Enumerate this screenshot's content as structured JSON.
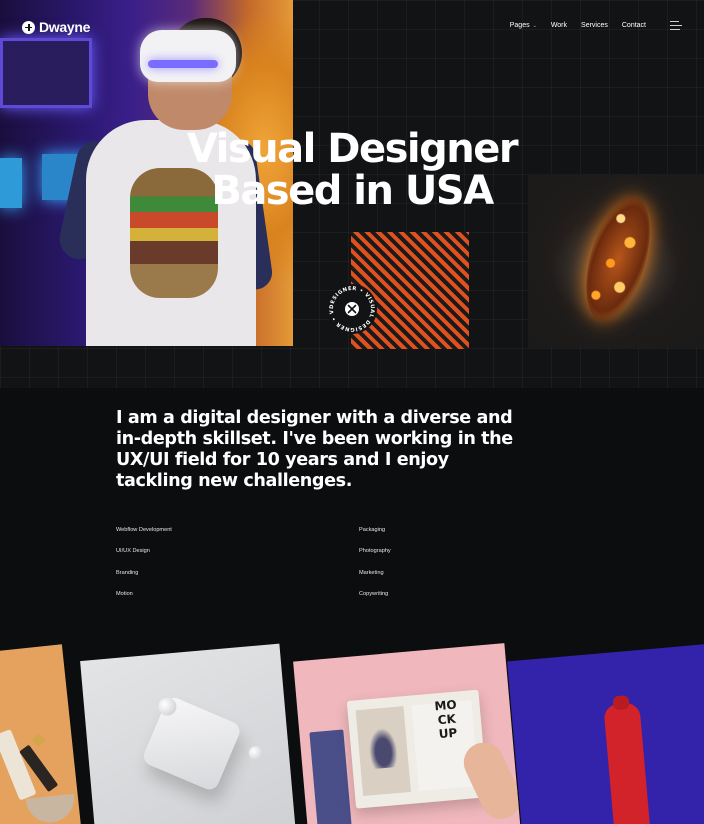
{
  "brand": {
    "name": "Dwayne"
  },
  "nav": {
    "items": [
      {
        "label": "Pages",
        "has_dropdown": true
      },
      {
        "label": "Work",
        "has_dropdown": false
      },
      {
        "label": "Services",
        "has_dropdown": false
      },
      {
        "label": "Contact",
        "has_dropdown": false
      }
    ],
    "caret": "⌄",
    "menu_icon": "hamburger-menu-icon"
  },
  "hero": {
    "title_line1": "Visual Designer",
    "title_line2": "Based in USA",
    "badge_text": "DESIGNER • VISUAL DESIGNER • VISUAL"
  },
  "intro": {
    "text": "I am a digital designer with a diverse and in-depth skillset. I've been working in the UX/UI field for 10 years and I enjoy tackling new challenges."
  },
  "skills": {
    "left": [
      "Webflow Development",
      "UI/UX Design",
      "Branding",
      "Motion"
    ],
    "right": [
      "Packaging",
      "Photography",
      "Marketing",
      "Copywriting"
    ]
  },
  "portfolio": {
    "mockup_text": "MOCKUP"
  },
  "colors": {
    "background": "#0c0d0e",
    "hero_grid": "#121314",
    "accent_orange": "#e0511f",
    "text": "#ffffff"
  }
}
